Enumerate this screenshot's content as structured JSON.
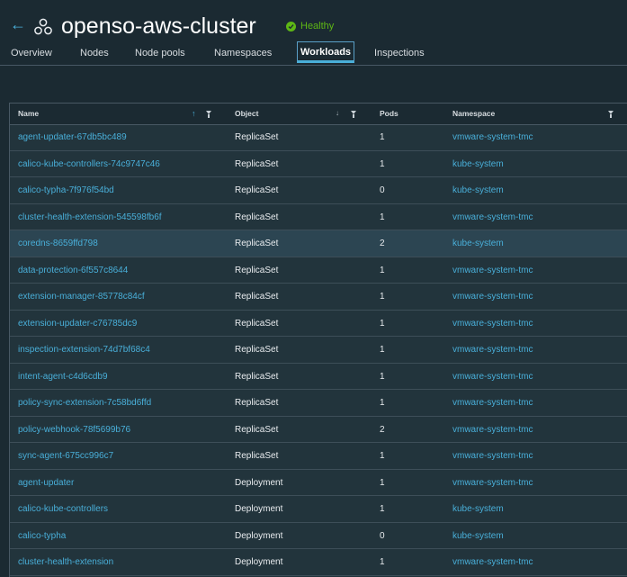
{
  "header": {
    "back_icon": "back-arrow-icon",
    "cluster_icon": "cluster-icon",
    "title": "openso-aws-cluster",
    "health": {
      "label": "Healthy",
      "color": "#5eb715"
    }
  },
  "tabs": [
    {
      "label": "Overview"
    },
    {
      "label": "Nodes"
    },
    {
      "label": "Node pools"
    },
    {
      "label": "Namespaces"
    },
    {
      "label": "Workloads",
      "active": true
    },
    {
      "label": "Inspections"
    }
  ],
  "table": {
    "columns": [
      "Name",
      "Object",
      "Pods",
      "Namespace"
    ],
    "rows": [
      {
        "name": "agent-updater-67db5bc489",
        "object": "ReplicaSet",
        "pods": "1",
        "namespace": "vmware-system-tmc"
      },
      {
        "name": "calico-kube-controllers-74c9747c46",
        "object": "ReplicaSet",
        "pods": "1",
        "namespace": "kube-system"
      },
      {
        "name": "calico-typha-7f976f54bd",
        "object": "ReplicaSet",
        "pods": "0",
        "namespace": "kube-system"
      },
      {
        "name": "cluster-health-extension-545598fb6f",
        "object": "ReplicaSet",
        "pods": "1",
        "namespace": "vmware-system-tmc"
      },
      {
        "name": "coredns-8659ffd798",
        "object": "ReplicaSet",
        "pods": "2",
        "namespace": "kube-system",
        "highlighted": true
      },
      {
        "name": "data-protection-6f557c8644",
        "object": "ReplicaSet",
        "pods": "1",
        "namespace": "vmware-system-tmc"
      },
      {
        "name": "extension-manager-85778c84cf",
        "object": "ReplicaSet",
        "pods": "1",
        "namespace": "vmware-system-tmc"
      },
      {
        "name": "extension-updater-c76785dc9",
        "object": "ReplicaSet",
        "pods": "1",
        "namespace": "vmware-system-tmc"
      },
      {
        "name": "inspection-extension-74d7bf68c4",
        "object": "ReplicaSet",
        "pods": "1",
        "namespace": "vmware-system-tmc"
      },
      {
        "name": "intent-agent-c4d6cdb9",
        "object": "ReplicaSet",
        "pods": "1",
        "namespace": "vmware-system-tmc"
      },
      {
        "name": "policy-sync-extension-7c58bd6ffd",
        "object": "ReplicaSet",
        "pods": "1",
        "namespace": "vmware-system-tmc"
      },
      {
        "name": "policy-webhook-78f5699b76",
        "object": "ReplicaSet",
        "pods": "2",
        "namespace": "vmware-system-tmc"
      },
      {
        "name": "sync-agent-675cc996c7",
        "object": "ReplicaSet",
        "pods": "1",
        "namespace": "vmware-system-tmc"
      },
      {
        "name": "agent-updater",
        "object": "Deployment",
        "pods": "1",
        "namespace": "vmware-system-tmc"
      },
      {
        "name": "calico-kube-controllers",
        "object": "Deployment",
        "pods": "1",
        "namespace": "kube-system"
      },
      {
        "name": "calico-typha",
        "object": "Deployment",
        "pods": "0",
        "namespace": "kube-system"
      },
      {
        "name": "cluster-health-extension",
        "object": "Deployment",
        "pods": "1",
        "namespace": "vmware-system-tmc"
      }
    ]
  },
  "colors": {
    "accent": "#49afd9",
    "background": "#1b2a32",
    "row_bg": "#22343c",
    "highlight_row": "#2c4552"
  }
}
